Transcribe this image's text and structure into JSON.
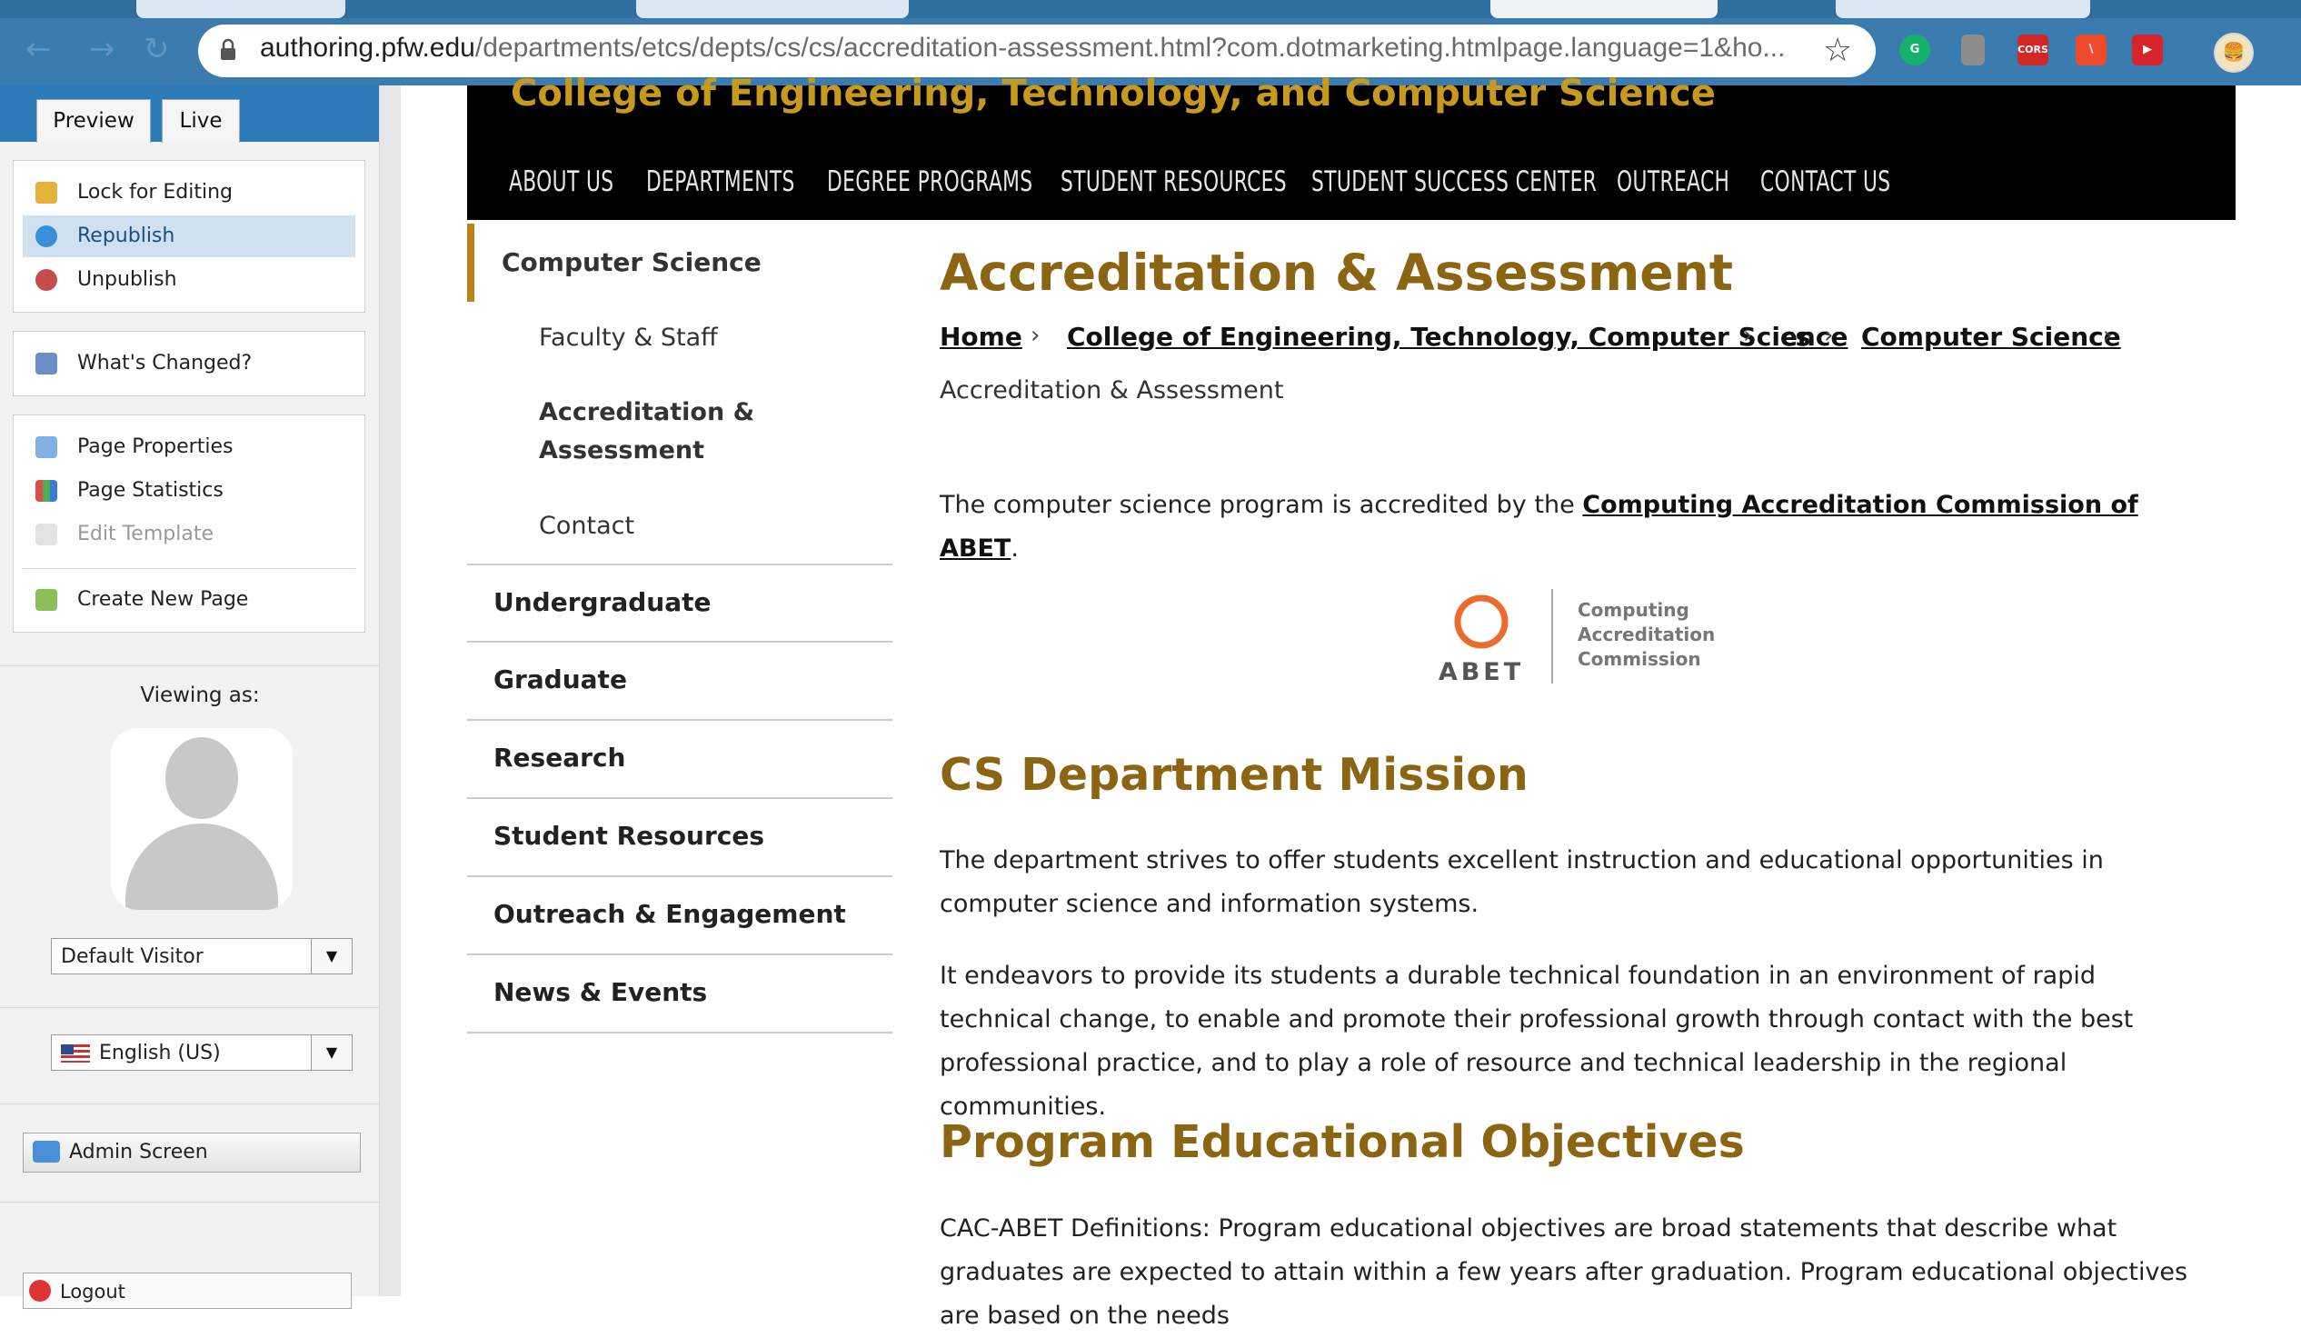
{
  "browser": {
    "url_host": "authoring.pfw.edu",
    "url_path": "/departments/etcs/depts/cs/cs/accreditation-assessment.html?com.dotmarketing.htmlpage.language=1&ho...",
    "ext_cors": "CORS"
  },
  "cms": {
    "tabs": [
      "Preview",
      "Live"
    ],
    "actions": [
      "Lock for Editing",
      "Republish",
      "Unpublish"
    ],
    "whats_changed": "What's Changed?",
    "page_actions": [
      "Page Properties",
      "Page Statistics",
      "Edit Template"
    ],
    "create_page": "Create New Page",
    "viewing_as": "Viewing as:",
    "visitor": "Default Visitor",
    "language": "English (US)",
    "admin_screen": "Admin Screen",
    "logout": "Logout"
  },
  "site": {
    "college": "College of Engineering, Technology, and Computer Science",
    "nav": [
      "ABOUT US",
      "DEPARTMENTS",
      "DEGREE PROGRAMS",
      "STUDENT RESOURCES",
      "STUDENT SUCCESS CENTER",
      "OUTREACH",
      "CONTACT US"
    ]
  },
  "leftnav": {
    "current": "Computer Science",
    "sub": [
      "Faculty & Staff",
      "Accreditation &",
      "Assessment",
      "Contact"
    ],
    "sections": [
      "Undergraduate",
      "Graduate",
      "Research",
      "Student Resources",
      "Outreach & Engagement",
      "News & Events"
    ]
  },
  "content": {
    "title": "Accreditation & Assessment",
    "breadcrumb": [
      "Home",
      "College of Engineering, Technology, Computer Science",
      "cs",
      "Computer Science"
    ],
    "breadcrumb_current": "Accreditation & Assessment",
    "accredited_text": "The computer science program is accredited by the",
    "accredited_link": "Computing Accreditation Commission of ABET",
    "accredited_end": ".",
    "abet_logo": {
      "wordmark": "ABET",
      "line1": "Computing",
      "line2": "Accreditation",
      "line3": "Commission"
    },
    "mission_heading": "CS Department Mission",
    "mission_p1": "The department strives to offer students excellent instruction and educational opportunities in computer science and information systems.",
    "mission_p2": "It endeavors to provide its students a durable technical foundation in an environment of rapid technical change, to enable and promote their professional growth through contact with the best professional practice, and to play a role of resource and technical leadership in the regional communities.",
    "objectives_heading": "Program Educational Objectives",
    "objectives_p1": "CAC-ABET Definitions: Program educational objectives are broad statements that describe what graduates are expected to attain within a few years after graduation. Program educational objectives are based on the needs"
  }
}
